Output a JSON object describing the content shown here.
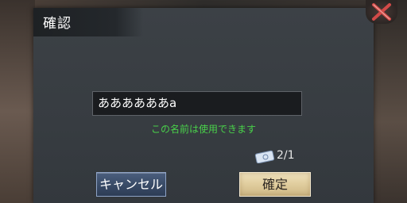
{
  "dialog": {
    "title": "確認",
    "name_value": "ああああああa",
    "status_message": "この名前は使用できます",
    "ticket_count": "2/1",
    "cancel_label": "キャンセル",
    "confirm_label": "確定"
  },
  "colors": {
    "status_green": "#49d14a",
    "close_red": "#c43a3a",
    "cancel_blue": "#3a4c68",
    "confirm_gold": "#e2cfa0"
  },
  "icons": {
    "close": "close-icon",
    "ticket": "ticket-icon"
  }
}
